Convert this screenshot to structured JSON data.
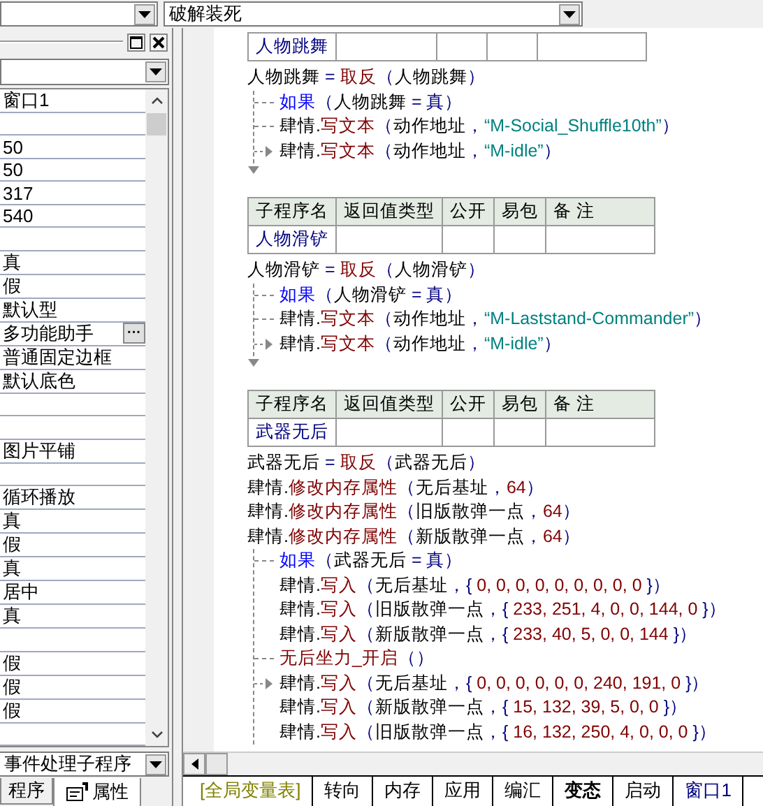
{
  "toolbar": {
    "method": "破解装死"
  },
  "properties": {
    "rows": [
      {
        "value": "窗口1"
      },
      {},
      {
        "value": "50"
      },
      {
        "value": "50"
      },
      {
        "value": "317"
      },
      {
        "value": "540"
      },
      {},
      {
        "value": "真"
      },
      {
        "value": "假"
      },
      {
        "value": "默认型"
      },
      {
        "value": "多功能助手",
        "button": "···"
      },
      {
        "value": "普通固定边框"
      },
      {
        "value": "默认底色"
      },
      {},
      {},
      {
        "value": "图片平铺"
      },
      {},
      {
        "value": "循环播放"
      },
      {
        "value": "真"
      },
      {
        "value": "假"
      },
      {
        "value": "真"
      },
      {
        "value": "居中"
      },
      {
        "value": "真"
      },
      {},
      {
        "value": "假"
      },
      {
        "value": "假"
      },
      {
        "value": "假"
      },
      {}
    ],
    "event_dropdown": "事件处理子程序",
    "tabs": [
      {
        "label": "程序",
        "selected": false
      },
      {
        "label": "属性",
        "selected": true
      }
    ]
  },
  "subprograms": [
    {
      "header": false,
      "name": "人物跳舞",
      "statements": [
        {
          "kind": "line",
          "segments": [
            {
              "kind": "t",
              "text": "人物跳舞"
            },
            {
              "kind": "p",
              "text": " = "
            },
            {
              "kind": "f",
              "text": "取反"
            },
            {
              "kind": "p",
              "text": "（"
            },
            {
              "kind": "t",
              "text": "人物跳舞"
            },
            {
              "kind": "p",
              "text": "）"
            }
          ]
        },
        {
          "kind": "if",
          "closed": true,
          "segments": [
            {
              "kind": "k",
              "text": "如果"
            },
            {
              "kind": "p",
              "text": "（"
            },
            {
              "kind": "t",
              "text": "人物跳舞"
            },
            {
              "kind": "p",
              "text": " = 真）"
            }
          ],
          "children": [
            {
              "kind": "branch",
              "segments": [
                {
                  "kind": "t",
                  "text": "肆情."
                },
                {
                  "kind": "f",
                  "text": "写文本"
                },
                {
                  "kind": "p",
                  "text": "（"
                },
                {
                  "kind": "t",
                  "text": "动作地址"
                },
                {
                  "kind": "p",
                  "text": "，"
                },
                {
                  "kind": "s",
                  "text": "“M-Social_Shuffle10th”"
                },
                {
                  "kind": "p",
                  "text": "）"
                }
              ]
            },
            {
              "kind": "end",
              "segments": [
                {
                  "kind": "t",
                  "text": "肆情."
                },
                {
                  "kind": "f",
                  "text": "写文本"
                },
                {
                  "kind": "p",
                  "text": "（"
                },
                {
                  "kind": "t",
                  "text": "动作地址"
                },
                {
                  "kind": "p",
                  "text": "，"
                },
                {
                  "kind": "s",
                  "text": "“M-idle”"
                },
                {
                  "kind": "p",
                  "text": "）"
                }
              ]
            }
          ]
        }
      ]
    },
    {
      "header": true,
      "columns": [
        "子程序名",
        "返回值类型",
        "公开",
        "易包",
        "备 注"
      ],
      "name": "人物滑铲",
      "statements": [
        {
          "kind": "line",
          "segments": [
            {
              "kind": "t",
              "text": "人物滑铲"
            },
            {
              "kind": "p",
              "text": " = "
            },
            {
              "kind": "f",
              "text": "取反"
            },
            {
              "kind": "p",
              "text": "（"
            },
            {
              "kind": "t",
              "text": "人物滑铲"
            },
            {
              "kind": "p",
              "text": "）"
            }
          ]
        },
        {
          "kind": "if",
          "closed": true,
          "segments": [
            {
              "kind": "k",
              "text": "如果"
            },
            {
              "kind": "p",
              "text": "（"
            },
            {
              "kind": "t",
              "text": "人物滑铲"
            },
            {
              "kind": "p",
              "text": " = 真）"
            }
          ],
          "children": [
            {
              "kind": "branch",
              "segments": [
                {
                  "kind": "t",
                  "text": "肆情."
                },
                {
                  "kind": "f",
                  "text": "写文本"
                },
                {
                  "kind": "p",
                  "text": "（"
                },
                {
                  "kind": "t",
                  "text": "动作地址"
                },
                {
                  "kind": "p",
                  "text": "，"
                },
                {
                  "kind": "s",
                  "text": "“M-Laststand-Commander”"
                },
                {
                  "kind": "p",
                  "text": "）"
                }
              ]
            },
            {
              "kind": "end",
              "segments": [
                {
                  "kind": "t",
                  "text": "肆情."
                },
                {
                  "kind": "f",
                  "text": "写文本"
                },
                {
                  "kind": "p",
                  "text": "（"
                },
                {
                  "kind": "t",
                  "text": "动作地址"
                },
                {
                  "kind": "p",
                  "text": "，"
                },
                {
                  "kind": "s",
                  "text": "“M-idle”"
                },
                {
                  "kind": "p",
                  "text": "）"
                }
              ]
            }
          ]
        }
      ]
    },
    {
      "header": true,
      "columns": [
        "子程序名",
        "返回值类型",
        "公开",
        "易包",
        "备 注"
      ],
      "name": "武器无后",
      "statements": [
        {
          "kind": "line",
          "segments": [
            {
              "kind": "t",
              "text": "武器无后"
            },
            {
              "kind": "p",
              "text": " = "
            },
            {
              "kind": "f",
              "text": "取反"
            },
            {
              "kind": "p",
              "text": "（"
            },
            {
              "kind": "t",
              "text": "武器无后"
            },
            {
              "kind": "p",
              "text": "）"
            }
          ]
        },
        {
          "kind": "line",
          "segments": [
            {
              "kind": "t",
              "text": "肆情."
            },
            {
              "kind": "f",
              "text": "修改内存属性"
            },
            {
              "kind": "p",
              "text": "（"
            },
            {
              "kind": "t",
              "text": "无后基址"
            },
            {
              "kind": "p",
              "text": "，"
            },
            {
              "kind": "n",
              "text": "64"
            },
            {
              "kind": "p",
              "text": "）"
            }
          ]
        },
        {
          "kind": "line",
          "segments": [
            {
              "kind": "t",
              "text": "肆情."
            },
            {
              "kind": "f",
              "text": "修改内存属性"
            },
            {
              "kind": "p",
              "text": "（"
            },
            {
              "kind": "t",
              "text": "旧版散弹一点"
            },
            {
              "kind": "p",
              "text": "，"
            },
            {
              "kind": "n",
              "text": "64"
            },
            {
              "kind": "p",
              "text": "）"
            }
          ]
        },
        {
          "kind": "line",
          "segments": [
            {
              "kind": "t",
              "text": "肆情."
            },
            {
              "kind": "f",
              "text": "修改内存属性"
            },
            {
              "kind": "p",
              "text": "（"
            },
            {
              "kind": "t",
              "text": "新版散弹一点"
            },
            {
              "kind": "p",
              "text": "，"
            },
            {
              "kind": "n",
              "text": "64"
            },
            {
              "kind": "p",
              "text": "）"
            }
          ]
        },
        {
          "kind": "if",
          "closed": false,
          "segments": [
            {
              "kind": "k",
              "text": "如果"
            },
            {
              "kind": "p",
              "text": "（"
            },
            {
              "kind": "t",
              "text": "武器无后"
            },
            {
              "kind": "p",
              "text": " = 真）"
            }
          ],
          "children": [
            {
              "kind": "plain",
              "segments": [
                {
                  "kind": "t",
                  "text": "肆情."
                },
                {
                  "kind": "f",
                  "text": "写入"
                },
                {
                  "kind": "p",
                  "text": "（"
                },
                {
                  "kind": "t",
                  "text": "无后基址"
                },
                {
                  "kind": "p",
                  "text": "，{ "
                },
                {
                  "kind": "n",
                  "text": "0, 0, 0, 0, 0, 0, 0, 0, 0"
                },
                {
                  "kind": "p",
                  "text": " }）"
                }
              ]
            },
            {
              "kind": "plain",
              "segments": [
                {
                  "kind": "t",
                  "text": "肆情."
                },
                {
                  "kind": "f",
                  "text": "写入"
                },
                {
                  "kind": "p",
                  "text": "（"
                },
                {
                  "kind": "t",
                  "text": "旧版散弹一点"
                },
                {
                  "kind": "p",
                  "text": "，{ "
                },
                {
                  "kind": "n",
                  "text": "233, 251, 4, 0, 0, 144, 0"
                },
                {
                  "kind": "p",
                  "text": " }）"
                }
              ]
            },
            {
              "kind": "plain",
              "segments": [
                {
                  "kind": "t",
                  "text": "肆情."
                },
                {
                  "kind": "f",
                  "text": "写入"
                },
                {
                  "kind": "p",
                  "text": "（"
                },
                {
                  "kind": "t",
                  "text": "新版散弹一点"
                },
                {
                  "kind": "p",
                  "text": "，{ "
                },
                {
                  "kind": "n",
                  "text": "233, 40, 5, 0, 0, 144"
                },
                {
                  "kind": "p",
                  "text": " }）"
                }
              ]
            },
            {
              "kind": "branch",
              "segments": [
                {
                  "kind": "f",
                  "text": "无后坐力_开启"
                },
                {
                  "kind": "p",
                  "text": "（）"
                }
              ]
            },
            {
              "kind": "end",
              "segments": [
                {
                  "kind": "t",
                  "text": "肆情."
                },
                {
                  "kind": "f",
                  "text": "写入"
                },
                {
                  "kind": "p",
                  "text": "（"
                },
                {
                  "kind": "t",
                  "text": "无后基址"
                },
                {
                  "kind": "p",
                  "text": "，{ "
                },
                {
                  "kind": "n",
                  "text": "0, 0, 0, 0, 0, 0, 240, 191, 0"
                },
                {
                  "kind": "p",
                  "text": " }）"
                }
              ]
            },
            {
              "kind": "plain",
              "segments": [
                {
                  "kind": "t",
                  "text": "肆情."
                },
                {
                  "kind": "f",
                  "text": "写入"
                },
                {
                  "kind": "p",
                  "text": "（"
                },
                {
                  "kind": "t",
                  "text": "新版散弹一点"
                },
                {
                  "kind": "p",
                  "text": "，{ "
                },
                {
                  "kind": "n",
                  "text": "15, 132, 39, 5, 0, 0"
                },
                {
                  "kind": "p",
                  "text": " }）"
                }
              ]
            },
            {
              "kind": "plain",
              "segments": [
                {
                  "kind": "t",
                  "text": "肆情."
                },
                {
                  "kind": "f",
                  "text": "写入"
                },
                {
                  "kind": "p",
                  "text": "（"
                },
                {
                  "kind": "t",
                  "text": "旧版散弹一点"
                },
                {
                  "kind": "p",
                  "text": "，{ "
                },
                {
                  "kind": "n",
                  "text": "16, 132, 250, 4, 0, 0, 0"
                },
                {
                  "kind": "p",
                  "text": " }）"
                }
              ]
            }
          ]
        }
      ]
    }
  ],
  "editor_tabs": [
    {
      "label": "[全局变量表]",
      "selected": false,
      "color": "#808000"
    },
    {
      "label": "转向",
      "selected": false,
      "color": "#000000"
    },
    {
      "label": "内存",
      "selected": false,
      "color": "#000000"
    },
    {
      "label": "应用",
      "selected": false,
      "color": "#000000"
    },
    {
      "label": "编汇",
      "selected": false,
      "color": "#000000"
    },
    {
      "label": "变态",
      "selected": true,
      "color": "#000000"
    },
    {
      "label": "启动",
      "selected": false,
      "color": "#000000"
    },
    {
      "label": "窗口1",
      "selected": false,
      "color": "#000080"
    }
  ]
}
